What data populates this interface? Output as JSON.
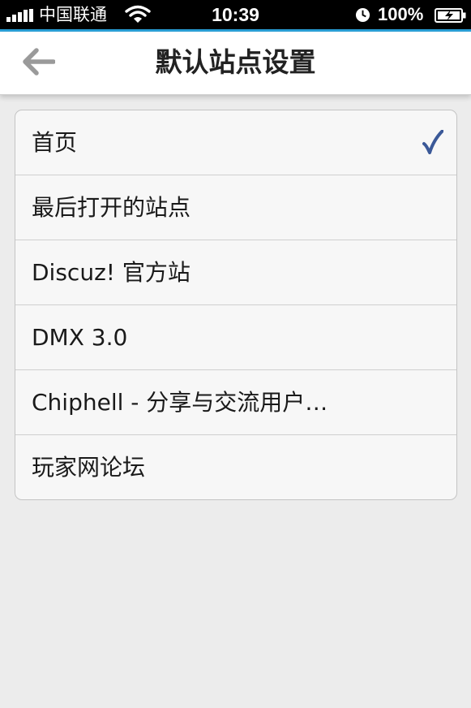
{
  "status_bar": {
    "carrier": "中国联通",
    "time": "10:39",
    "battery": "100%"
  },
  "nav": {
    "title": "默认站点设置",
    "back_icon": "back-arrow-icon"
  },
  "site_list": {
    "selected_index": 0,
    "items": [
      {
        "label": "首页"
      },
      {
        "label": "最后打开的站点"
      },
      {
        "label": "Discuz! 官方站"
      },
      {
        "label": "DMX 3.0"
      },
      {
        "label": "Chiphell - 分享与交流用户…"
      },
      {
        "label": "玩家网论坛"
      }
    ]
  },
  "colors": {
    "accent": "#2aa0d8",
    "check": "#3b5998",
    "background": "#ececec"
  }
}
